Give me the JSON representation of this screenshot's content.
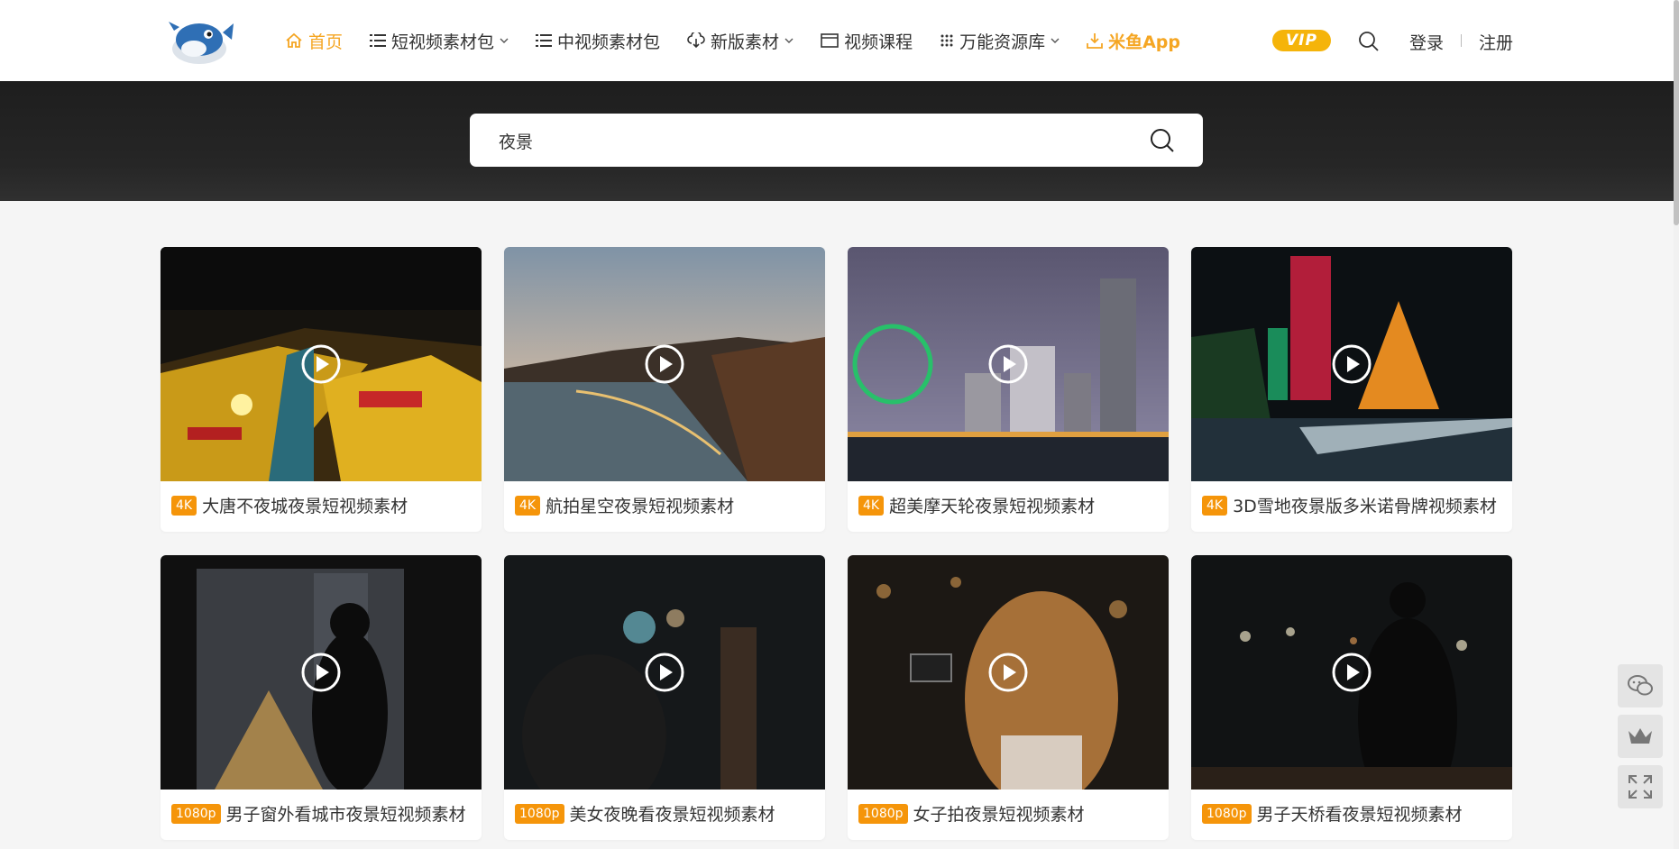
{
  "header": {
    "nav": [
      {
        "label": "首页",
        "icon": "home-icon",
        "active": true,
        "dropdown": false
      },
      {
        "label": "短视频素材包",
        "icon": "list-icon",
        "active": false,
        "dropdown": true
      },
      {
        "label": "中视频素材包",
        "icon": "list-icon",
        "active": false,
        "dropdown": false
      },
      {
        "label": "新版素材",
        "icon": "cloud-download-icon",
        "active": false,
        "dropdown": true
      },
      {
        "label": "视频课程",
        "icon": "window-icon",
        "active": false,
        "dropdown": false
      },
      {
        "label": "万能资源库",
        "icon": "grid-icon",
        "active": false,
        "dropdown": true
      },
      {
        "label": "米鱼App",
        "icon": "download-icon",
        "active": false,
        "dropdown": false
      }
    ],
    "vip_label": "VIP",
    "login_label": "登录",
    "register_label": "注册"
  },
  "search": {
    "value": "夜景"
  },
  "colors": {
    "accent": "#f5a623",
    "badge": "#f5950a",
    "banner": "#222222"
  },
  "results": [
    {
      "badge": "4K",
      "title": "大唐不夜城夜景短视频素材"
    },
    {
      "badge": "4K",
      "title": "航拍星空夜景短视频素材"
    },
    {
      "badge": "4K",
      "title": "超美摩天轮夜景短视频素材"
    },
    {
      "badge": "4K",
      "title": "3D雪地夜景版多米诺骨牌视频素材"
    },
    {
      "badge": "1080p",
      "title": "男子窗外看城市夜景短视频素材"
    },
    {
      "badge": "1080p",
      "title": "美女夜晚看夜景短视频素材"
    },
    {
      "badge": "1080p",
      "title": "女子拍夜景短视频素材"
    },
    {
      "badge": "1080p",
      "title": "男子天桥看夜景短视频素材"
    }
  ],
  "float_tools": [
    "wechat-icon",
    "crown-icon",
    "fullscreen-icon"
  ]
}
